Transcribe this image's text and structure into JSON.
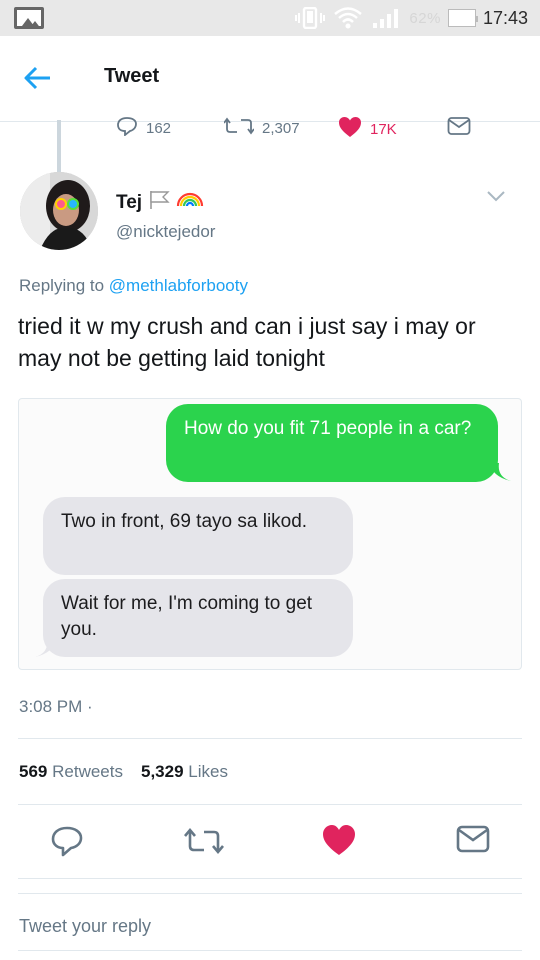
{
  "status_bar": {
    "battery_percent": "62%",
    "time": "17:43"
  },
  "app_bar": {
    "title": "Tweet"
  },
  "parent_tweet_actions": {
    "reply_count": "162",
    "retweet_count": "2,307",
    "like_count": "17K"
  },
  "tweet": {
    "author_name": "Tej",
    "author_handle": "@nicktejedor",
    "replying_prefix": "Replying to",
    "replying_to": "@methlabforbooty",
    "text": "tried it w my crush and can i just say i may or may not be getting laid tonight",
    "timestamp": "3:08 PM ·",
    "retweets_count": "569",
    "retweets_label": "Retweets",
    "likes_count": "5,329",
    "likes_label": "Likes"
  },
  "media_messages": [
    {
      "from": "me",
      "text": "How do you fit 71 people in a car?"
    },
    {
      "from": "them",
      "text": "Two in front, 69 tayo sa likod."
    },
    {
      "from": "them",
      "text": "Wait for me, I'm coming to get you."
    }
  ],
  "reply_box": {
    "placeholder": "Tweet your reply"
  },
  "colors": {
    "twitter_blue": "#1da1f2",
    "like_red": "#e0245e",
    "imessage_green": "#2bd34d",
    "bubble_gray": "#e5e5ea",
    "text_gray": "#657786"
  },
  "icons": [
    "gallery-icon",
    "vibrate-icon",
    "wifi-icon",
    "signal-icon",
    "battery-icon",
    "back-arrow-icon",
    "reply-icon",
    "retweet-icon",
    "heart-icon",
    "message-icon",
    "chevron-down-icon",
    "flag-icon",
    "rainbow-icon"
  ]
}
